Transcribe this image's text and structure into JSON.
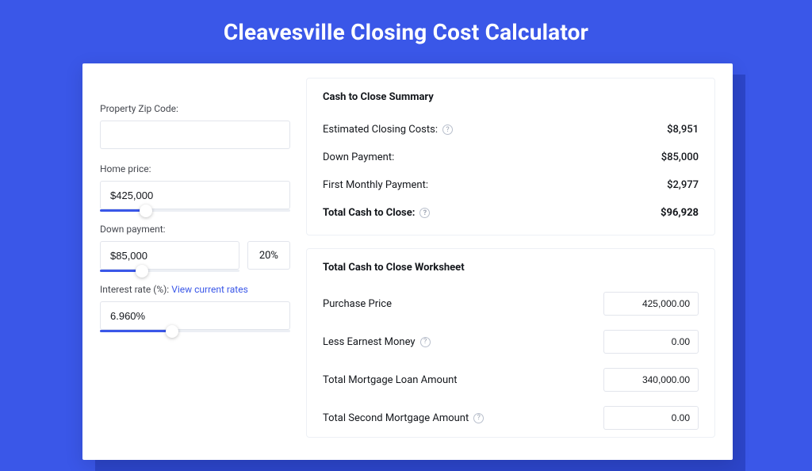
{
  "page": {
    "title": "Cleavesville Closing Cost Calculator"
  },
  "left": {
    "zip": {
      "label": "Property Zip Code:",
      "value": ""
    },
    "homePrice": {
      "label": "Home price:",
      "value": "$425,000",
      "sliderPct": 24
    },
    "downPayment": {
      "label": "Down payment:",
      "value": "$85,000",
      "pct": "20%",
      "sliderPct": 30
    },
    "interestRate": {
      "label": "Interest rate (%):",
      "link": "View current rates",
      "value": "6.960%",
      "sliderPct": 38
    }
  },
  "summary": {
    "title": "Cash to Close Summary",
    "rows": [
      {
        "label": "Estimated Closing Costs:",
        "value": "$8,951",
        "help": true
      },
      {
        "label": "Down Payment:",
        "value": "$85,000",
        "help": false
      },
      {
        "label": "First Monthly Payment:",
        "value": "$2,977",
        "help": false
      }
    ],
    "total": {
      "label": "Total Cash to Close:",
      "value": "$96,928",
      "help": true
    }
  },
  "worksheet": {
    "title": "Total Cash to Close Worksheet",
    "rows": [
      {
        "label": "Purchase Price",
        "value": "425,000.00",
        "help": false
      },
      {
        "label": "Less Earnest Money",
        "value": "0.00",
        "help": true
      },
      {
        "label": "Total Mortgage Loan Amount",
        "value": "340,000.00",
        "help": false
      },
      {
        "label": "Total Second Mortgage Amount",
        "value": "0.00",
        "help": true
      }
    ]
  }
}
